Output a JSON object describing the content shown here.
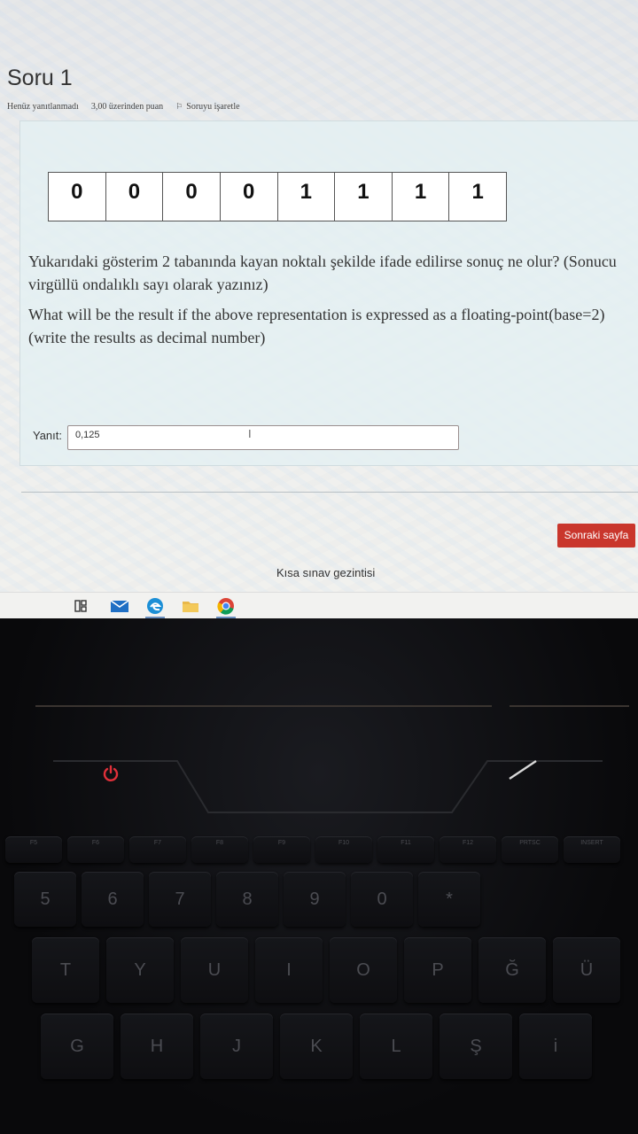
{
  "question": {
    "title": "Soru 1",
    "status": "Henüz yanıtlanmadı",
    "points": "3,00 üzerinden puan",
    "flag_label": "Soruyu işaretle",
    "bits": [
      "0",
      "0",
      "0",
      "0",
      "1",
      "1",
      "1",
      "1"
    ],
    "text_tr": "Yukarıdaki gösterim 2 tabanında kayan noktalı şekilde ifade edilirse sonuç ne olur? (Sonucu virgüllü ondalıklı sayı olarak yazınız)",
    "text_en": "What will be the result if the above representation is expressed as a floating-point(base=2) (write the results as decimal number)",
    "answer_label": "Yanıt:",
    "answer_value": "0,125"
  },
  "footer": {
    "next_button": "Sonraki sayfa",
    "quiz_nav": "Kısa sınav gezintisi"
  },
  "taskbar": {
    "icons": [
      "task-view-icon",
      "mail-icon",
      "edge-icon",
      "file-explorer-icon",
      "chrome-icon"
    ]
  },
  "keyboard": {
    "fn_keys": [
      "F5",
      "F6",
      "F7",
      "F8",
      "F9",
      "F10",
      "F11",
      "F12",
      "PRTSC",
      "INSERT"
    ],
    "number_row": [
      "5",
      "6",
      "7",
      "8",
      "9",
      "0",
      "*"
    ],
    "top_row": [
      "T",
      "Y",
      "U",
      "I",
      "O",
      "P",
      "Ğ",
      "Ü"
    ],
    "home_row": [
      "G",
      "H",
      "J",
      "K",
      "L",
      "Ş",
      "i"
    ]
  },
  "colors": {
    "accent_button": "#c9362c",
    "keyboard_led": "#e0303a"
  }
}
